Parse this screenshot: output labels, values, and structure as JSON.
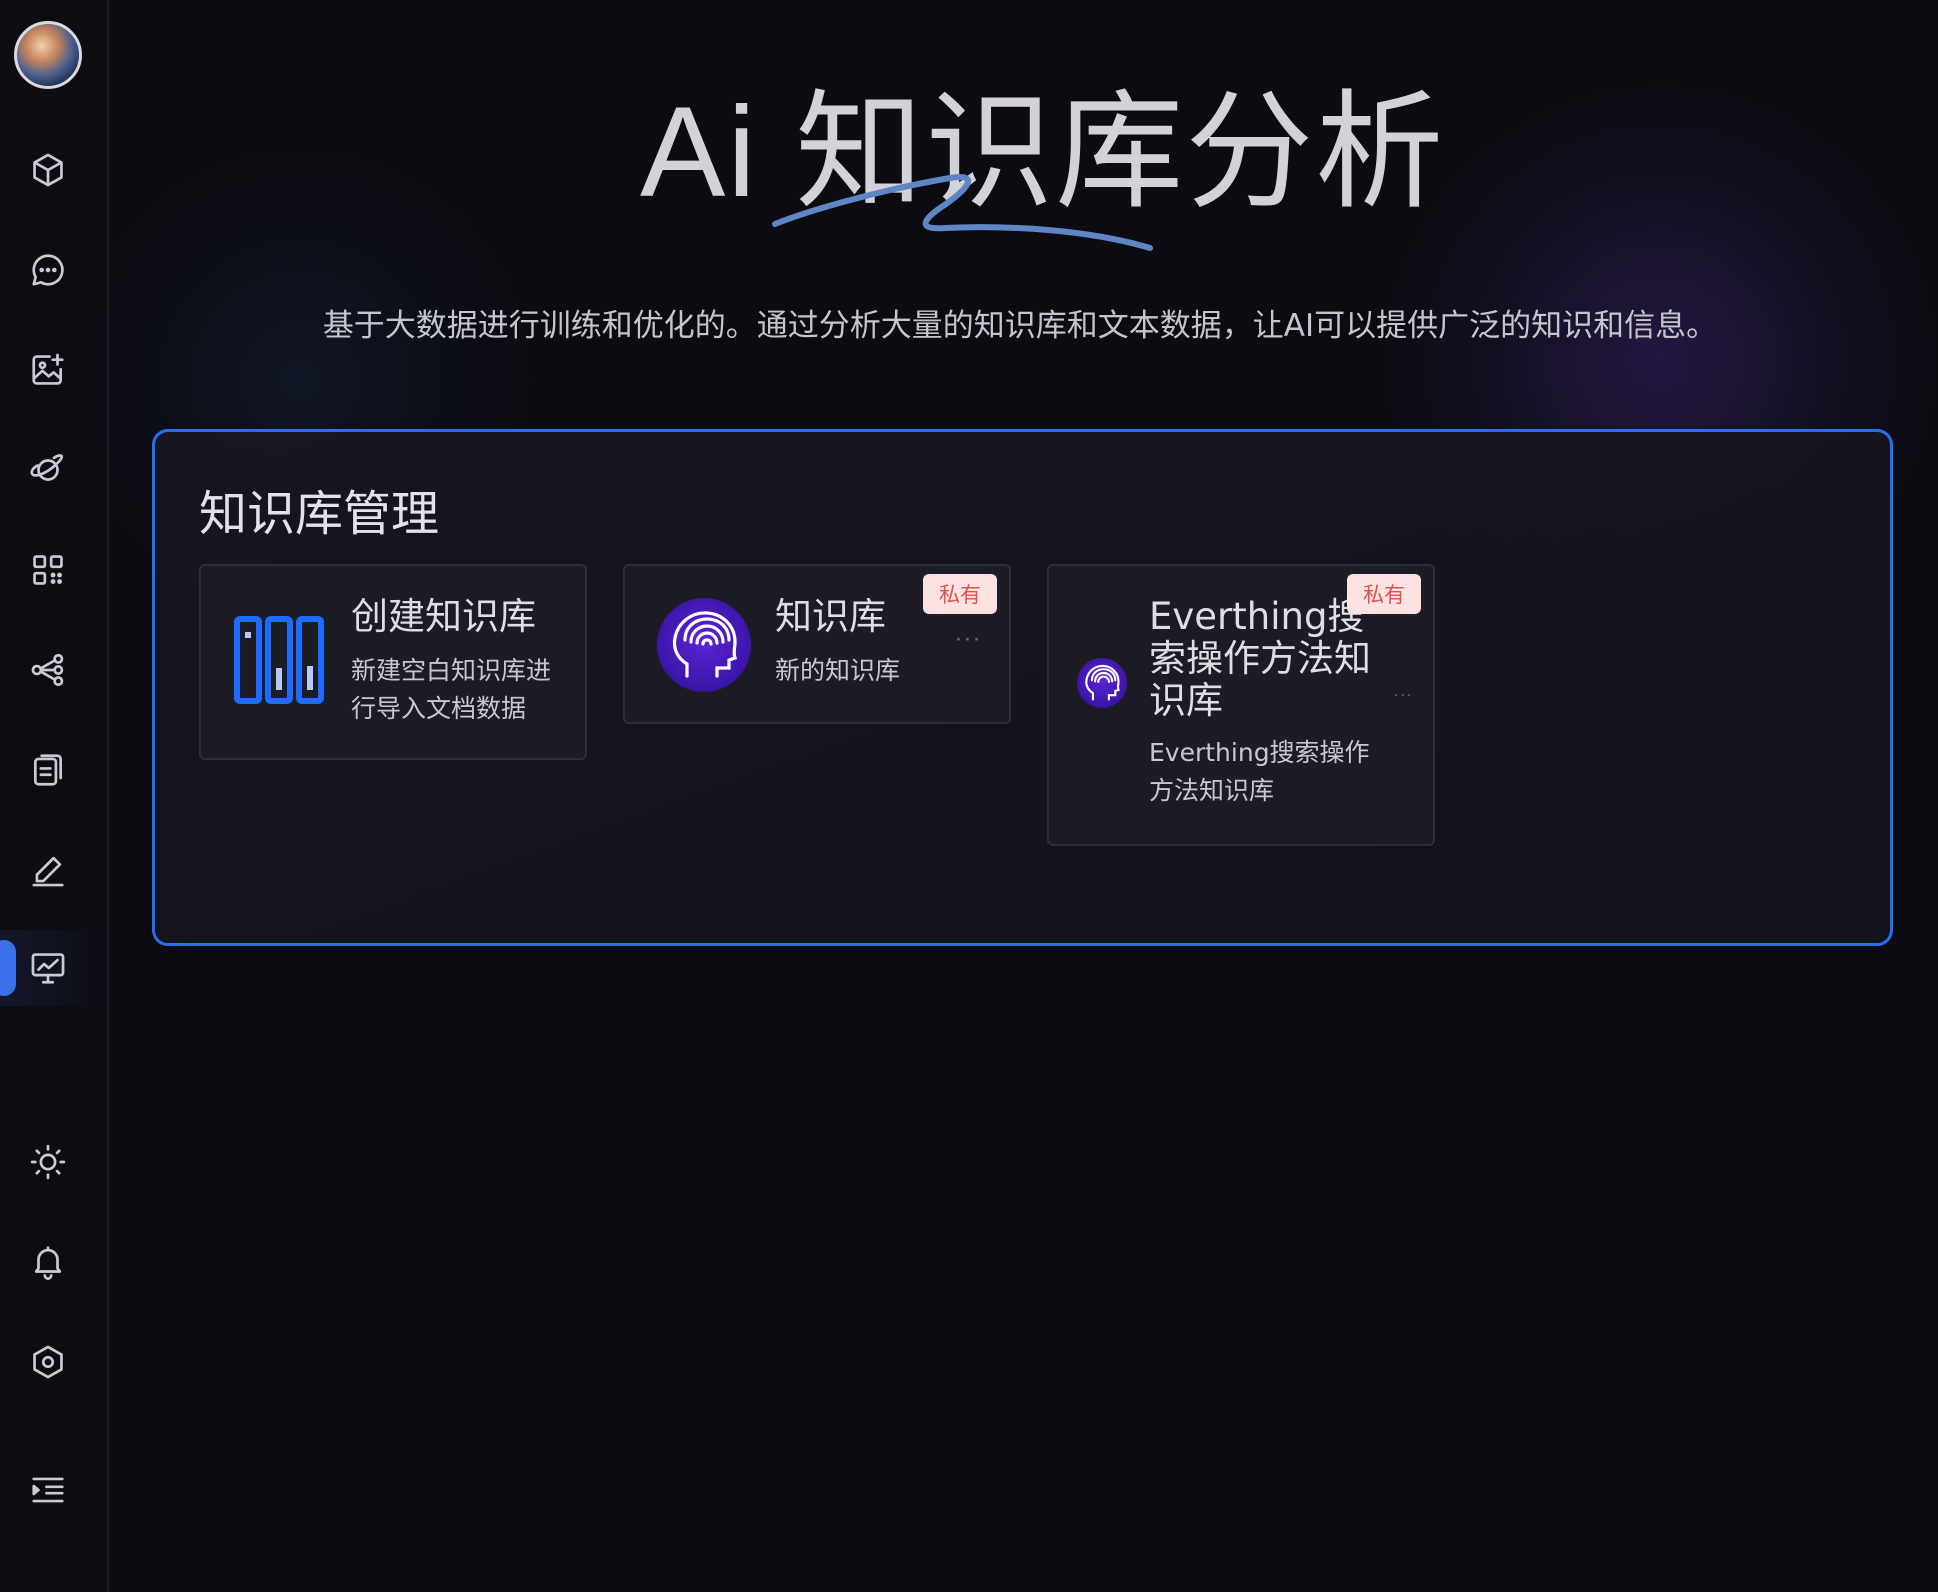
{
  "app": {
    "hero_title": "Ai 知识库分析",
    "subtitle": "基于大数据进行训练和优化的。通过分析大量的知识库和文本数据，让AI可以提供广泛的知识和信息。"
  },
  "sidebar": {
    "items": [
      {
        "icon": "cube-icon"
      },
      {
        "icon": "chat-bubble-icon"
      },
      {
        "icon": "image-add-icon"
      },
      {
        "icon": "planet-icon"
      },
      {
        "icon": "apps-grid-icon"
      },
      {
        "icon": "share-nodes-icon"
      },
      {
        "icon": "document-icon"
      },
      {
        "icon": "edit-pen-icon"
      },
      {
        "icon": "monitor-chart-icon",
        "active": true
      }
    ],
    "bottom_items": [
      {
        "icon": "sun-icon"
      },
      {
        "icon": "bell-icon"
      },
      {
        "icon": "settings-hex-icon"
      },
      {
        "icon": "collapse-menu-icon"
      }
    ]
  },
  "panel": {
    "title": "知识库管理",
    "cards": [
      {
        "title": "创建知识库",
        "description": "新建空白知识库进行导入文档数据",
        "icon": "library-books-icon"
      },
      {
        "title": "知识库",
        "description": "新的知识库",
        "badge": "私有",
        "more": "···",
        "icon": "brain-head-icon"
      },
      {
        "title": "Everthing搜索操作方法知识库",
        "description": "Everthing搜索操作方法知识库",
        "badge": "私有",
        "more": "···",
        "icon": "brain-head-icon"
      }
    ]
  },
  "colors": {
    "accent": "#2a6ef0",
    "badge_bg": "#fde2e2",
    "badge_text": "#d9534f",
    "brain_purple": "#4a1cc0"
  }
}
